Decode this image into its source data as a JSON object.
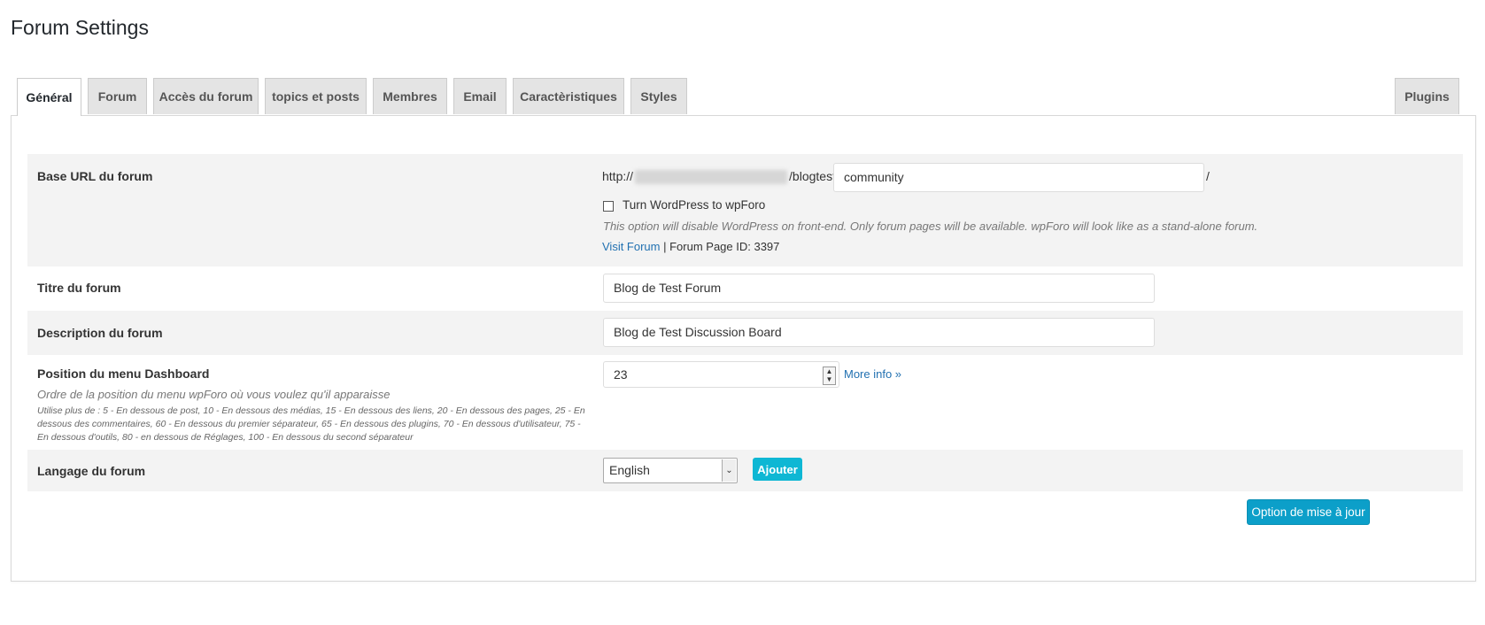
{
  "page": {
    "title": "Forum Settings"
  },
  "tabs": [
    {
      "label": "Général"
    },
    {
      "label": "Forum"
    },
    {
      "label": "Accès du forum"
    },
    {
      "label": "topics et posts"
    },
    {
      "label": "Membres"
    },
    {
      "label": "Email"
    },
    {
      "label": "Caractèristiques"
    },
    {
      "label": "Styles"
    },
    {
      "label": "Plugins"
    }
  ],
  "general": {
    "base_url": {
      "label": "Base URL du forum",
      "prefix": "http://",
      "path": "/blogtest/",
      "value": "community",
      "suffix": "/",
      "checkbox_label": "Turn WordPress to wpForo",
      "checkbox_checked": false,
      "hint": "This option will disable WordPress on front-end. Only forum pages will be available. wpForo will look like as a stand-alone forum.",
      "visit_link": "Visit Forum",
      "separator": " | ",
      "page_id": "Forum Page ID: 3397"
    },
    "title": {
      "label": "Titre du forum",
      "value": "Blog de Test Forum"
    },
    "description": {
      "label": "Description du forum",
      "value": "Blog de Test Discussion Board"
    },
    "menu_position": {
      "label": "Position du menu Dashboard",
      "hint": "Ordre de la position du menu wpForo où vous voulez qu'il apparaisse",
      "details": "Utilise plus de : 5 - En dessous de post, 10 - En dessous des médias, 15 - En dessous des liens, 20 - En dessous des pages, 25 - En dessous des commentaires, 60 - En dessous du premier séparateur, 65 - En dessous des plugins, 70 - En dessous d'utilisateur, 75 - En dessous d'outils, 80 - en dessous de Réglages, 100 - En dessous du second séparateur",
      "value": "23",
      "more_info": "More info »"
    },
    "language": {
      "label": "Langage du forum",
      "selected": "English",
      "add_button": "Ajouter"
    }
  },
  "actions": {
    "update_button": "Option de mise à jour"
  },
  "colors": {
    "accent_button": "#0eb7d4",
    "primary_button": "#0c9fc9",
    "link": "#2271b1",
    "row_shade": "#f3f3f3"
  },
  "icons": {
    "spinner": "up-down-arrows",
    "select": "chevron-down"
  }
}
